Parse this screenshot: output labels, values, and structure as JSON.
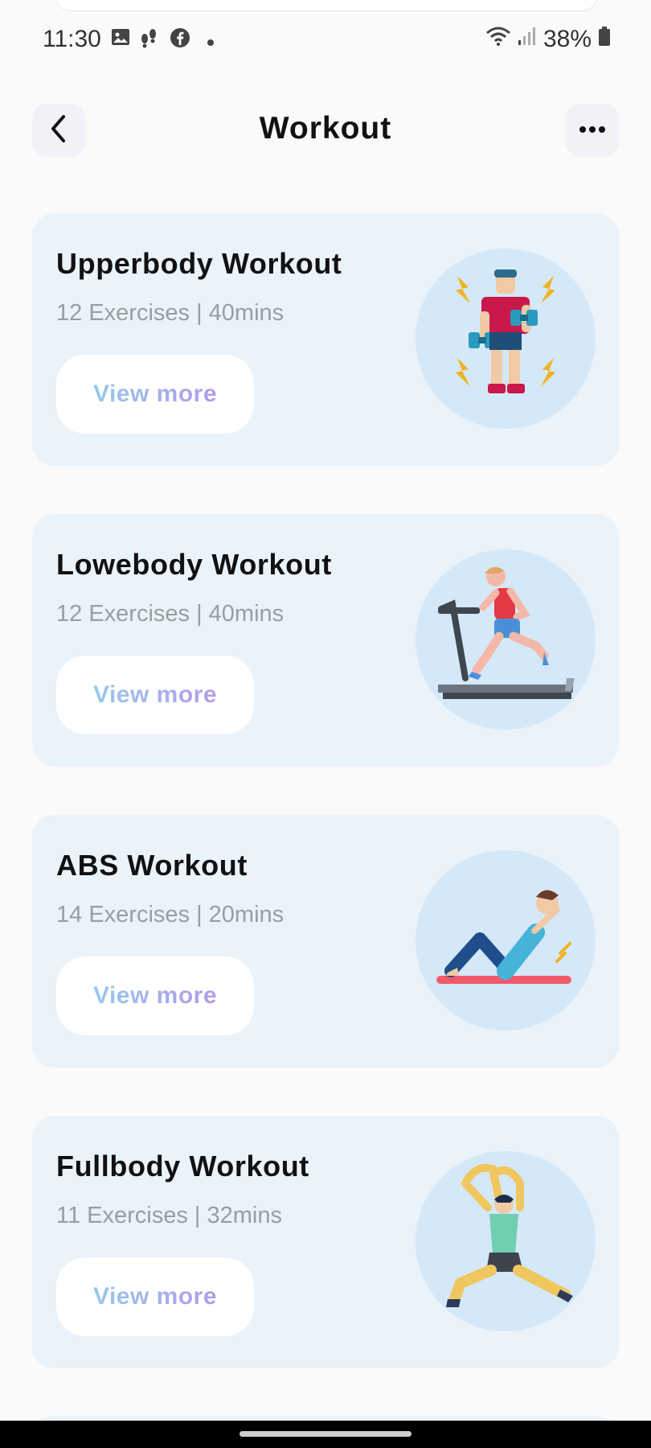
{
  "status_bar": {
    "time": "11:30",
    "battery": "38%",
    "icons": [
      "gallery-icon",
      "steps-icon",
      "facebook-icon",
      "dot-icon",
      "wifi-icon",
      "signal-icon",
      "battery-icon"
    ]
  },
  "header": {
    "title": "Workout",
    "back_icon": "chevron-left-icon",
    "more_icon": "more-horizontal-icon"
  },
  "workouts": [
    {
      "title": "Upperbody Workout",
      "meta": "12 Exercises | 40mins",
      "button": "View more",
      "illustration": "dumbbell-man-icon"
    },
    {
      "title": "Lowebody Workout",
      "meta": "12 Exercises | 40mins",
      "button": "View more",
      "illustration": "treadmill-runner-icon"
    },
    {
      "title": "ABS Workout",
      "meta": "14 Exercises | 20mins",
      "button": "View more",
      "illustration": "situp-woman-icon"
    },
    {
      "title": "Fullbody Workout",
      "meta": "11 Exercises | 32mins",
      "button": "View more",
      "illustration": "stretching-man-icon"
    }
  ],
  "colors": {
    "background": "#fafafa",
    "card": "#eaf2fa",
    "illustration_circle": "#d4e8f7",
    "button_text_gradient_start": "#97c9ec",
    "button_text_gradient_end": "#b49be8",
    "meta_text": "#9a9da3"
  }
}
